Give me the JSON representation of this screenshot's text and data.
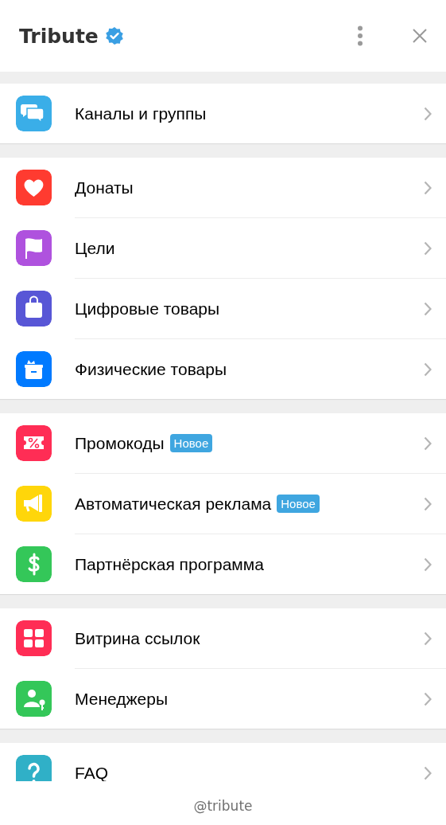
{
  "header": {
    "title": "Tribute",
    "verified": true
  },
  "groups": [
    {
      "items": [
        {
          "label": "Каналы и группы",
          "kind": "chat",
          "color": "#3aaee8"
        }
      ]
    },
    {
      "items": [
        {
          "label": "Донаты",
          "kind": "heart",
          "color": "#ff3b30"
        },
        {
          "label": "Цели",
          "kind": "flag",
          "color": "#af52de"
        },
        {
          "label": "Цифровые товары",
          "kind": "bag",
          "color": "#5856d6"
        },
        {
          "label": "Физические товары",
          "kind": "box",
          "color": "#007aff"
        }
      ]
    },
    {
      "items": [
        {
          "label": "Промокоды",
          "badge": "Новое",
          "kind": "percent",
          "color": "#ff2d55"
        },
        {
          "label": "Автоматическая реклама",
          "badge": "Новое",
          "kind": "megaphone",
          "color": "#ffd60a"
        },
        {
          "label": "Партнёрская программа",
          "kind": "dollar",
          "color": "#34c759"
        }
      ]
    },
    {
      "items": [
        {
          "label": "Витрина ссылок",
          "kind": "grid",
          "color": "#ff2d55"
        },
        {
          "label": "Менеджеры",
          "kind": "manager",
          "color": "#34c759"
        }
      ]
    },
    {
      "items": [
        {
          "label": "FAQ",
          "kind": "question",
          "color": "#30b0c7"
        }
      ]
    }
  ],
  "footer": "@tribute"
}
